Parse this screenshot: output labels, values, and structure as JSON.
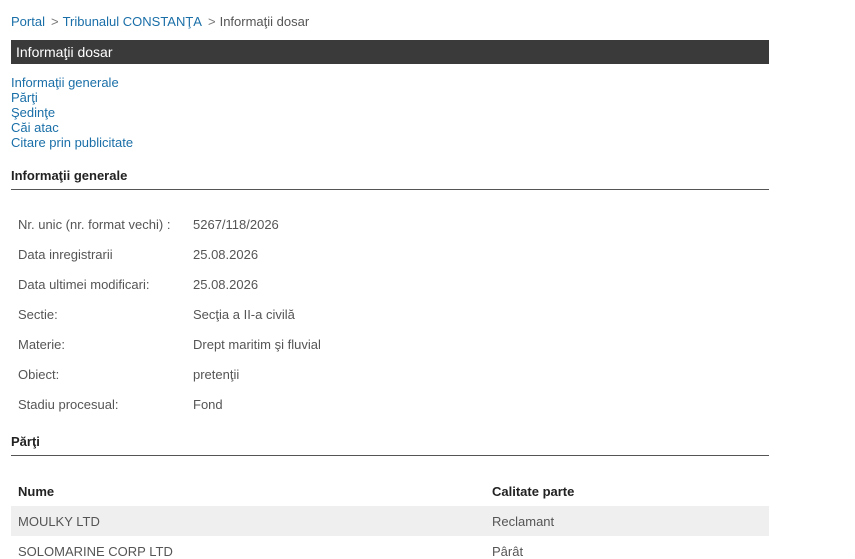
{
  "breadcrumb": {
    "portal": "Portal",
    "court": "Tribunalul CONSTANŢA",
    "current": "Informaţii dosar",
    "sep": ">"
  },
  "title": "Informaţii dosar",
  "anchors": [
    "Informaţii generale",
    "Părţi",
    "Şedinţe",
    "Căi atac",
    "Citare prin publicitate"
  ],
  "general": {
    "heading": "Informaţii generale",
    "rows": [
      {
        "label": "Nr. unic (nr. format vechi) :",
        "value": "5267/118/2026"
      },
      {
        "label": "Data inregistrarii",
        "value": "25.08.2026"
      },
      {
        "label": "Data ultimei modificari:",
        "value": "25.08.2026"
      },
      {
        "label": "Sectie:",
        "value": "Secţia a II-a civilă"
      },
      {
        "label": "Materie:",
        "value": "Drept maritim şi fluvial"
      },
      {
        "label": "Obiect:",
        "value": "pretenţii"
      },
      {
        "label": "Stadiu procesual:",
        "value": "Fond"
      }
    ]
  },
  "parti": {
    "heading": "Părţi",
    "columns": [
      "Nume",
      "Calitate parte"
    ],
    "rows": [
      {
        "name": "MOULKY LTD",
        "role": "Reclamant"
      },
      {
        "name": "SOLOMARINE CORP LTD",
        "role": "Pârât"
      }
    ]
  }
}
